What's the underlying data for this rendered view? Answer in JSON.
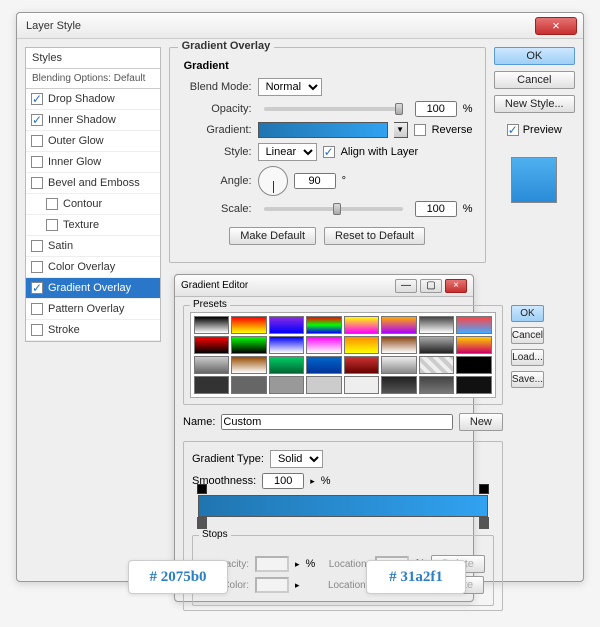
{
  "window": {
    "title": "Layer Style"
  },
  "styles_panel": {
    "header": "Styles",
    "sub": "Blending Options: Default",
    "items": [
      {
        "label": "Drop Shadow",
        "checked": true
      },
      {
        "label": "Inner Shadow",
        "checked": true
      },
      {
        "label": "Outer Glow",
        "checked": false
      },
      {
        "label": "Inner Glow",
        "checked": false
      },
      {
        "label": "Bevel and Emboss",
        "checked": false
      },
      {
        "label": "Contour",
        "checked": false,
        "indent": true
      },
      {
        "label": "Texture",
        "checked": false,
        "indent": true
      },
      {
        "label": "Satin",
        "checked": false
      },
      {
        "label": "Color Overlay",
        "checked": false
      },
      {
        "label": "Gradient Overlay",
        "checked": true,
        "selected": true
      },
      {
        "label": "Pattern Overlay",
        "checked": false
      },
      {
        "label": "Stroke",
        "checked": false
      }
    ]
  },
  "gradient_overlay": {
    "title": "Gradient Overlay",
    "subtitle": "Gradient",
    "blend_mode_label": "Blend Mode:",
    "blend_mode": "Normal",
    "opacity_label": "Opacity:",
    "opacity": "100",
    "pct": "%",
    "gradient_label": "Gradient:",
    "reverse_label": "Reverse",
    "style_label": "Style:",
    "style": "Linear",
    "align_label": "Align with Layer",
    "angle_label": "Angle:",
    "angle": "90",
    "deg": "°",
    "scale_label": "Scale:",
    "scale": "100",
    "make_default": "Make Default",
    "reset_default": "Reset to Default"
  },
  "right": {
    "ok": "OK",
    "cancel": "Cancel",
    "new_style": "New Style...",
    "preview": "Preview"
  },
  "editor": {
    "title": "Gradient Editor",
    "presets_label": "Presets",
    "name_label": "Name:",
    "name": "Custom",
    "new_btn": "New",
    "ok": "OK",
    "cancel": "Cancel",
    "load": "Load...",
    "save": "Save...",
    "grad_type_label": "Gradient Type:",
    "grad_type": "Solid",
    "smoothness_label": "Smoothness:",
    "smoothness": "100",
    "pct": "%",
    "stops_title": "Stops",
    "opacity_lbl": "Opacity:",
    "location_lbl": "Location:",
    "delete_lbl": "Delete",
    "color_lbl": "Color:"
  },
  "hex": {
    "left": "# 2075b0",
    "right": "# 31a2f1"
  },
  "preset_colors": [
    "linear-gradient(#000,#fff)",
    "linear-gradient(#f00,#ff0)",
    "linear-gradient(#8a2be2,#00f)",
    "linear-gradient(#f00,#0f0,#00f)",
    "linear-gradient(#ff0,#f0f)",
    "linear-gradient(#fa0,#a0f)",
    "linear-gradient(#444,#fff)",
    "linear-gradient(#f44,#4af)",
    "linear-gradient(#f00,#000)",
    "linear-gradient(#0f0,#000)",
    "linear-gradient(#00f,#fff)",
    "linear-gradient(#f0f,#fff)",
    "linear-gradient(#ff8c00,#ff0)",
    "linear-gradient(#8b4513,#fff)",
    "linear-gradient(#aaa,#222)",
    "linear-gradient(#fc0,#c06)",
    "linear-gradient(#ccc,#666)",
    "linear-gradient(#964b00,#fff)",
    "linear-gradient(#0c6,#063)",
    "linear-gradient(#06c,#039)",
    "linear-gradient(#c33,#600)",
    "linear-gradient(#eee,#888)",
    "repeating-linear-gradient(45deg,#ccc 0 4px,#eee 4px 8px)",
    "linear-gradient(#000,#000)",
    "linear-gradient(#333,#333)",
    "linear-gradient(#666,#666)",
    "linear-gradient(#999,#999)",
    "linear-gradient(#ccc,#ccc)",
    "linear-gradient(#eee,#eee)",
    "linear-gradient(#222,#555)",
    "linear-gradient(#444,#777)",
    "linear-gradient(#111,#111)"
  ]
}
